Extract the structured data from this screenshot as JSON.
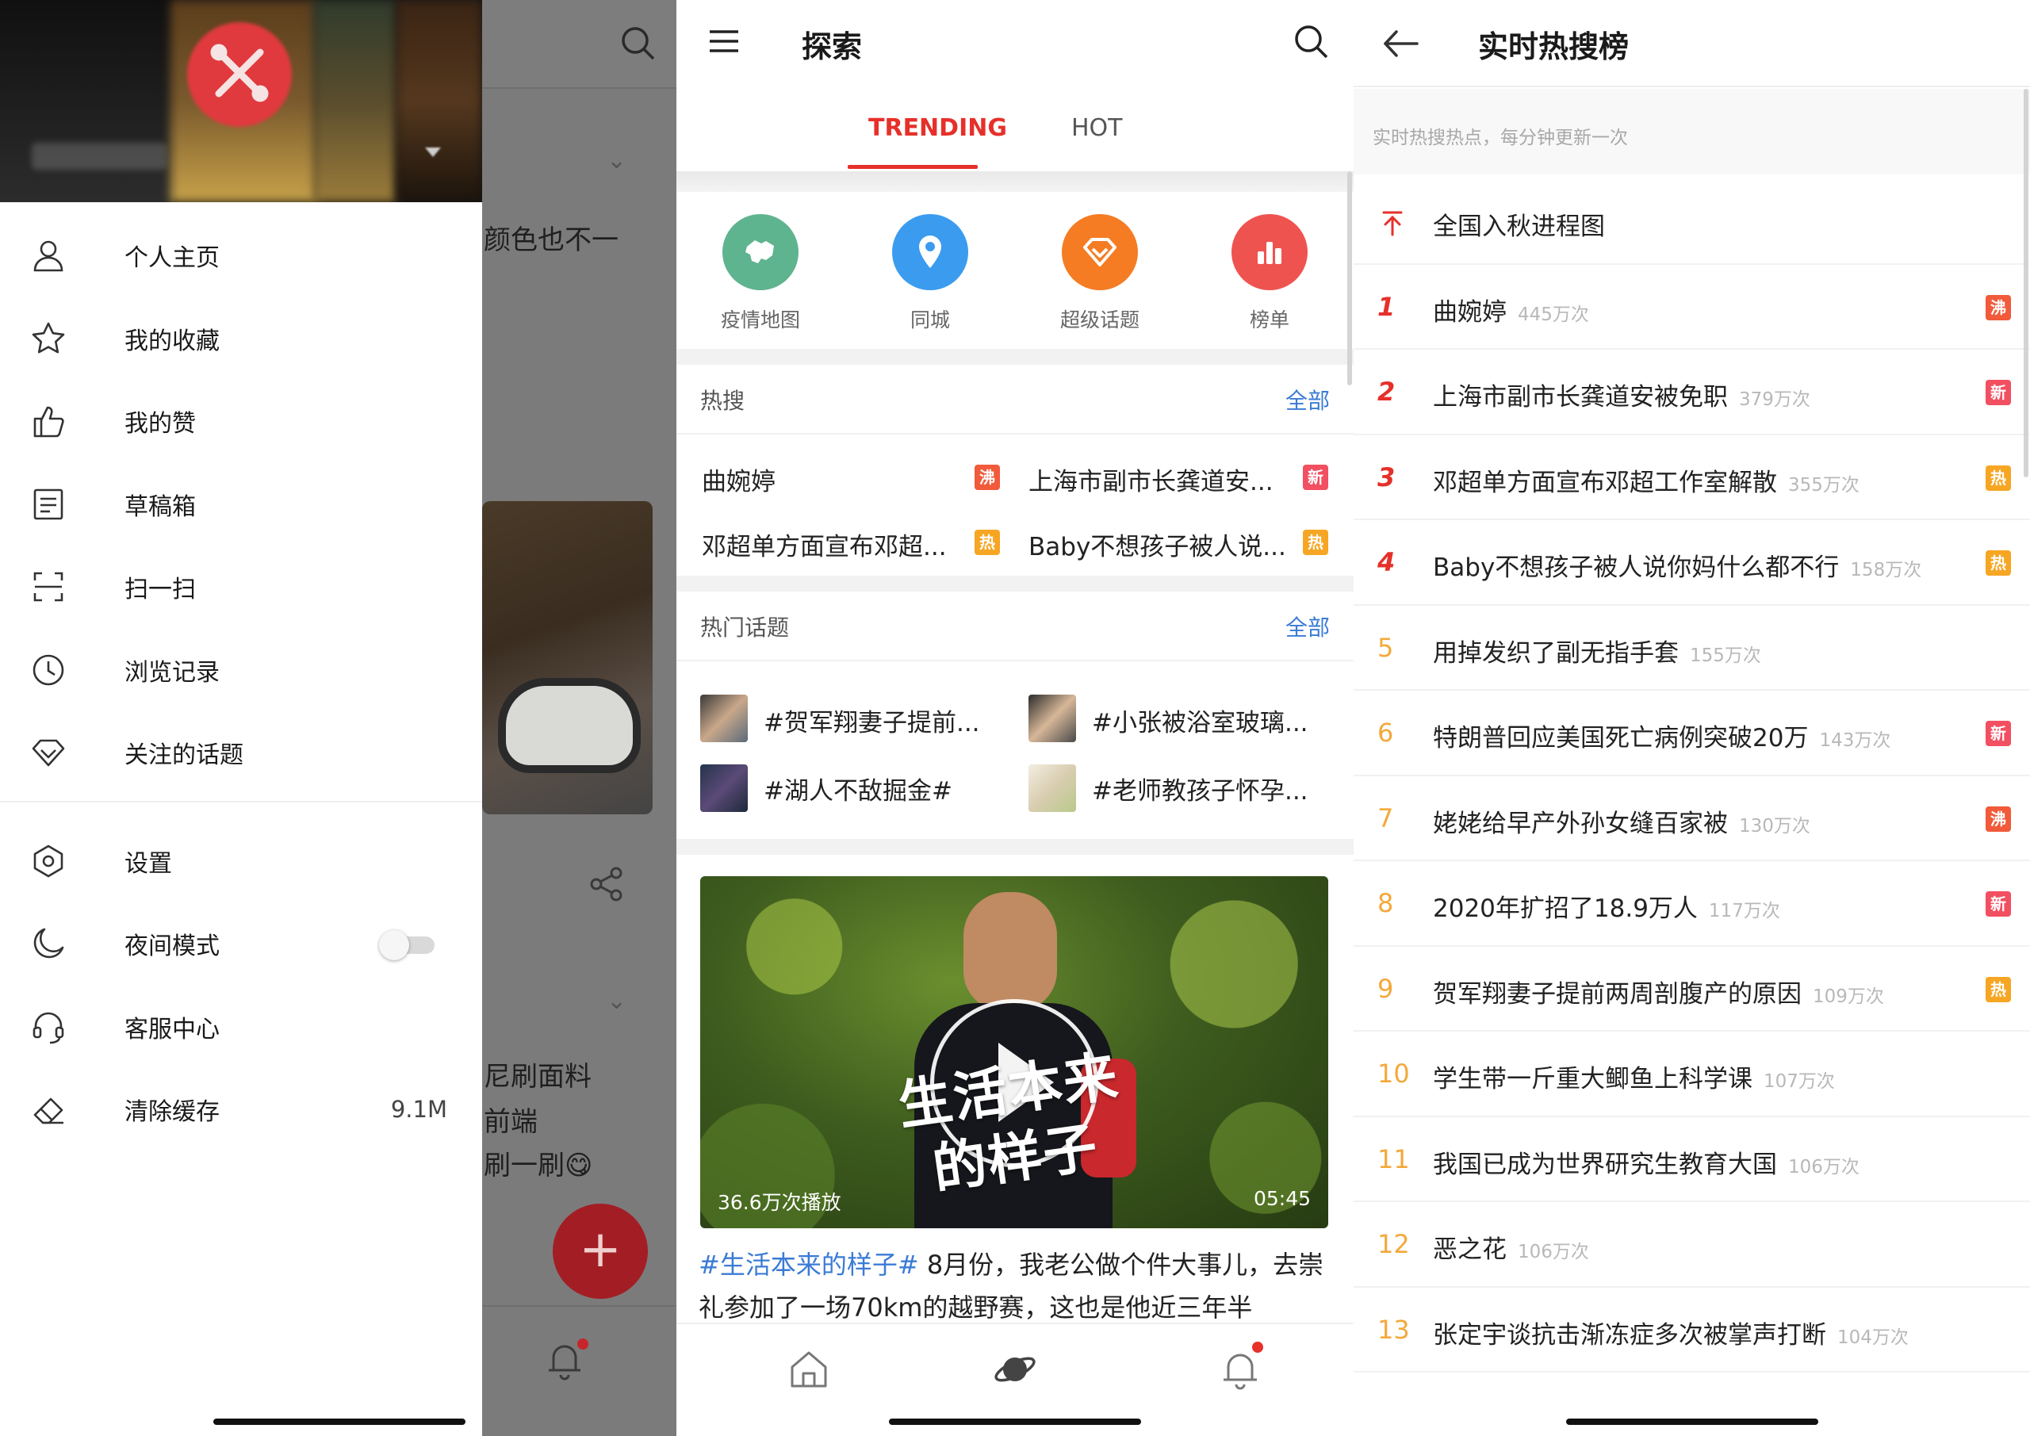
{
  "drawer_panel": {
    "background_feed": {
      "partial_text_1": "颜色也不一",
      "partial_text_2": "尼刷面料",
      "partial_text_3": "前端",
      "partial_text_4": "刷一刷😋",
      "fab_symbol": "+"
    },
    "menu_items": [
      {
        "label": "个人主页",
        "icon": "person-icon"
      },
      {
        "label": "我的收藏",
        "icon": "star-icon"
      },
      {
        "label": "我的赞",
        "icon": "thumb-up-icon"
      },
      {
        "label": "草稿箱",
        "icon": "draft-icon"
      },
      {
        "label": "扫一扫",
        "icon": "scan-icon"
      },
      {
        "label": "浏览记录",
        "icon": "clock-icon"
      },
      {
        "label": "关注的话题",
        "icon": "diamond-icon"
      }
    ],
    "settings_items": [
      {
        "label": "设置",
        "icon": "hexagon-gear-icon"
      },
      {
        "label": "夜间模式",
        "icon": "moon-icon",
        "toggle_on": false
      },
      {
        "label": "客服中心",
        "icon": "headset-icon"
      },
      {
        "label": "清除缓存",
        "icon": "eraser-icon",
        "value": "9.1M"
      }
    ]
  },
  "explore_panel": {
    "title": "探索",
    "tabs": [
      {
        "label": "TRENDING",
        "active": true
      },
      {
        "label": "HOT",
        "active": false
      }
    ],
    "quick_links": [
      {
        "label": "疫情地图",
        "icon": "map-icon",
        "color": "#5eb48f"
      },
      {
        "label": "同城",
        "icon": "location-pin-icon",
        "color": "#3b9bef"
      },
      {
        "label": "超级话题",
        "icon": "diamond-icon",
        "color": "#f57c22"
      },
      {
        "label": "榜单",
        "icon": "bar-chart-icon",
        "color": "#ef5350"
      }
    ],
    "hot_search": {
      "heading": "热搜",
      "all_label": "全部",
      "items": [
        {
          "text": "曲婉婷",
          "tag": "沸"
        },
        {
          "text": "上海市副市长龚道安...",
          "tag": "新"
        },
        {
          "text": "邓超单方面宣布邓超...",
          "tag": "热"
        },
        {
          "text": "Baby不想孩子被人说...",
          "tag": "热"
        }
      ]
    },
    "hot_topics": {
      "heading": "热门话题",
      "all_label": "全部",
      "items": [
        {
          "text": "#贺军翔妻子提前..."
        },
        {
          "text": "#小张被浴室玻璃..."
        },
        {
          "text": "#湖人不敌掘金#"
        },
        {
          "text": "#老师教孩子怀孕..."
        }
      ]
    },
    "video": {
      "caption_line1": "生活本来",
      "caption_line2": "的样子",
      "plays": "36.6万次播放",
      "duration": "05:45"
    },
    "post": {
      "hashtag": "#生活本来的样子#",
      "text": " 8月份，我老公做个件大事儿，去崇礼参加了一场70km的越野赛，这也是他近三年半"
    }
  },
  "hotlist_panel": {
    "title": "实时热搜榜",
    "subtitle": "实时热搜热点，每分钟更新一次",
    "pinned": {
      "title": "全国入秋进程图"
    },
    "items": [
      {
        "rank": "1",
        "title": "曲婉婷",
        "count": "445万次",
        "tag": "沸"
      },
      {
        "rank": "2",
        "title": "上海市副市长龚道安被免职",
        "count": "379万次",
        "tag": "新"
      },
      {
        "rank": "3",
        "title": "邓超单方面宣布邓超工作室解散",
        "count": "355万次",
        "tag": "热"
      },
      {
        "rank": "4",
        "title": "Baby不想孩子被人说你妈什么都不行",
        "count": "158万次",
        "tag": "热"
      },
      {
        "rank": "5",
        "title": "用掉发织了副无指手套",
        "count": "155万次",
        "tag": ""
      },
      {
        "rank": "6",
        "title": "特朗普回应美国死亡病例突破20万",
        "count": "143万次",
        "tag": "新"
      },
      {
        "rank": "7",
        "title": "姥姥给早产外孙女缝百家被",
        "count": "130万次",
        "tag": "沸"
      },
      {
        "rank": "8",
        "title": "2020年扩招了18.9万人",
        "count": "117万次",
        "tag": "新"
      },
      {
        "rank": "9",
        "title": "贺军翔妻子提前两周剖腹产的原因",
        "count": "109万次",
        "tag": "热"
      },
      {
        "rank": "10",
        "title": "学生带一斤重大鲫鱼上科学课",
        "count": "107万次",
        "tag": ""
      },
      {
        "rank": "11",
        "title": "我国已成为世界研究生教育大国",
        "count": "106万次",
        "tag": ""
      },
      {
        "rank": "12",
        "title": "恶之花",
        "count": "106万次",
        "tag": ""
      },
      {
        "rank": "13",
        "title": "张定宇谈抗击渐冻症多次被掌声打断",
        "count": "104万次",
        "tag": ""
      }
    ]
  },
  "colors": {
    "accent_red": "#e6302a",
    "link_blue": "#3a7bd5",
    "tag_boil": "#f15a3a",
    "tag_new": "#f24f61",
    "tag_hot": "#f6a623",
    "rank_orange": "#f3a93a"
  }
}
